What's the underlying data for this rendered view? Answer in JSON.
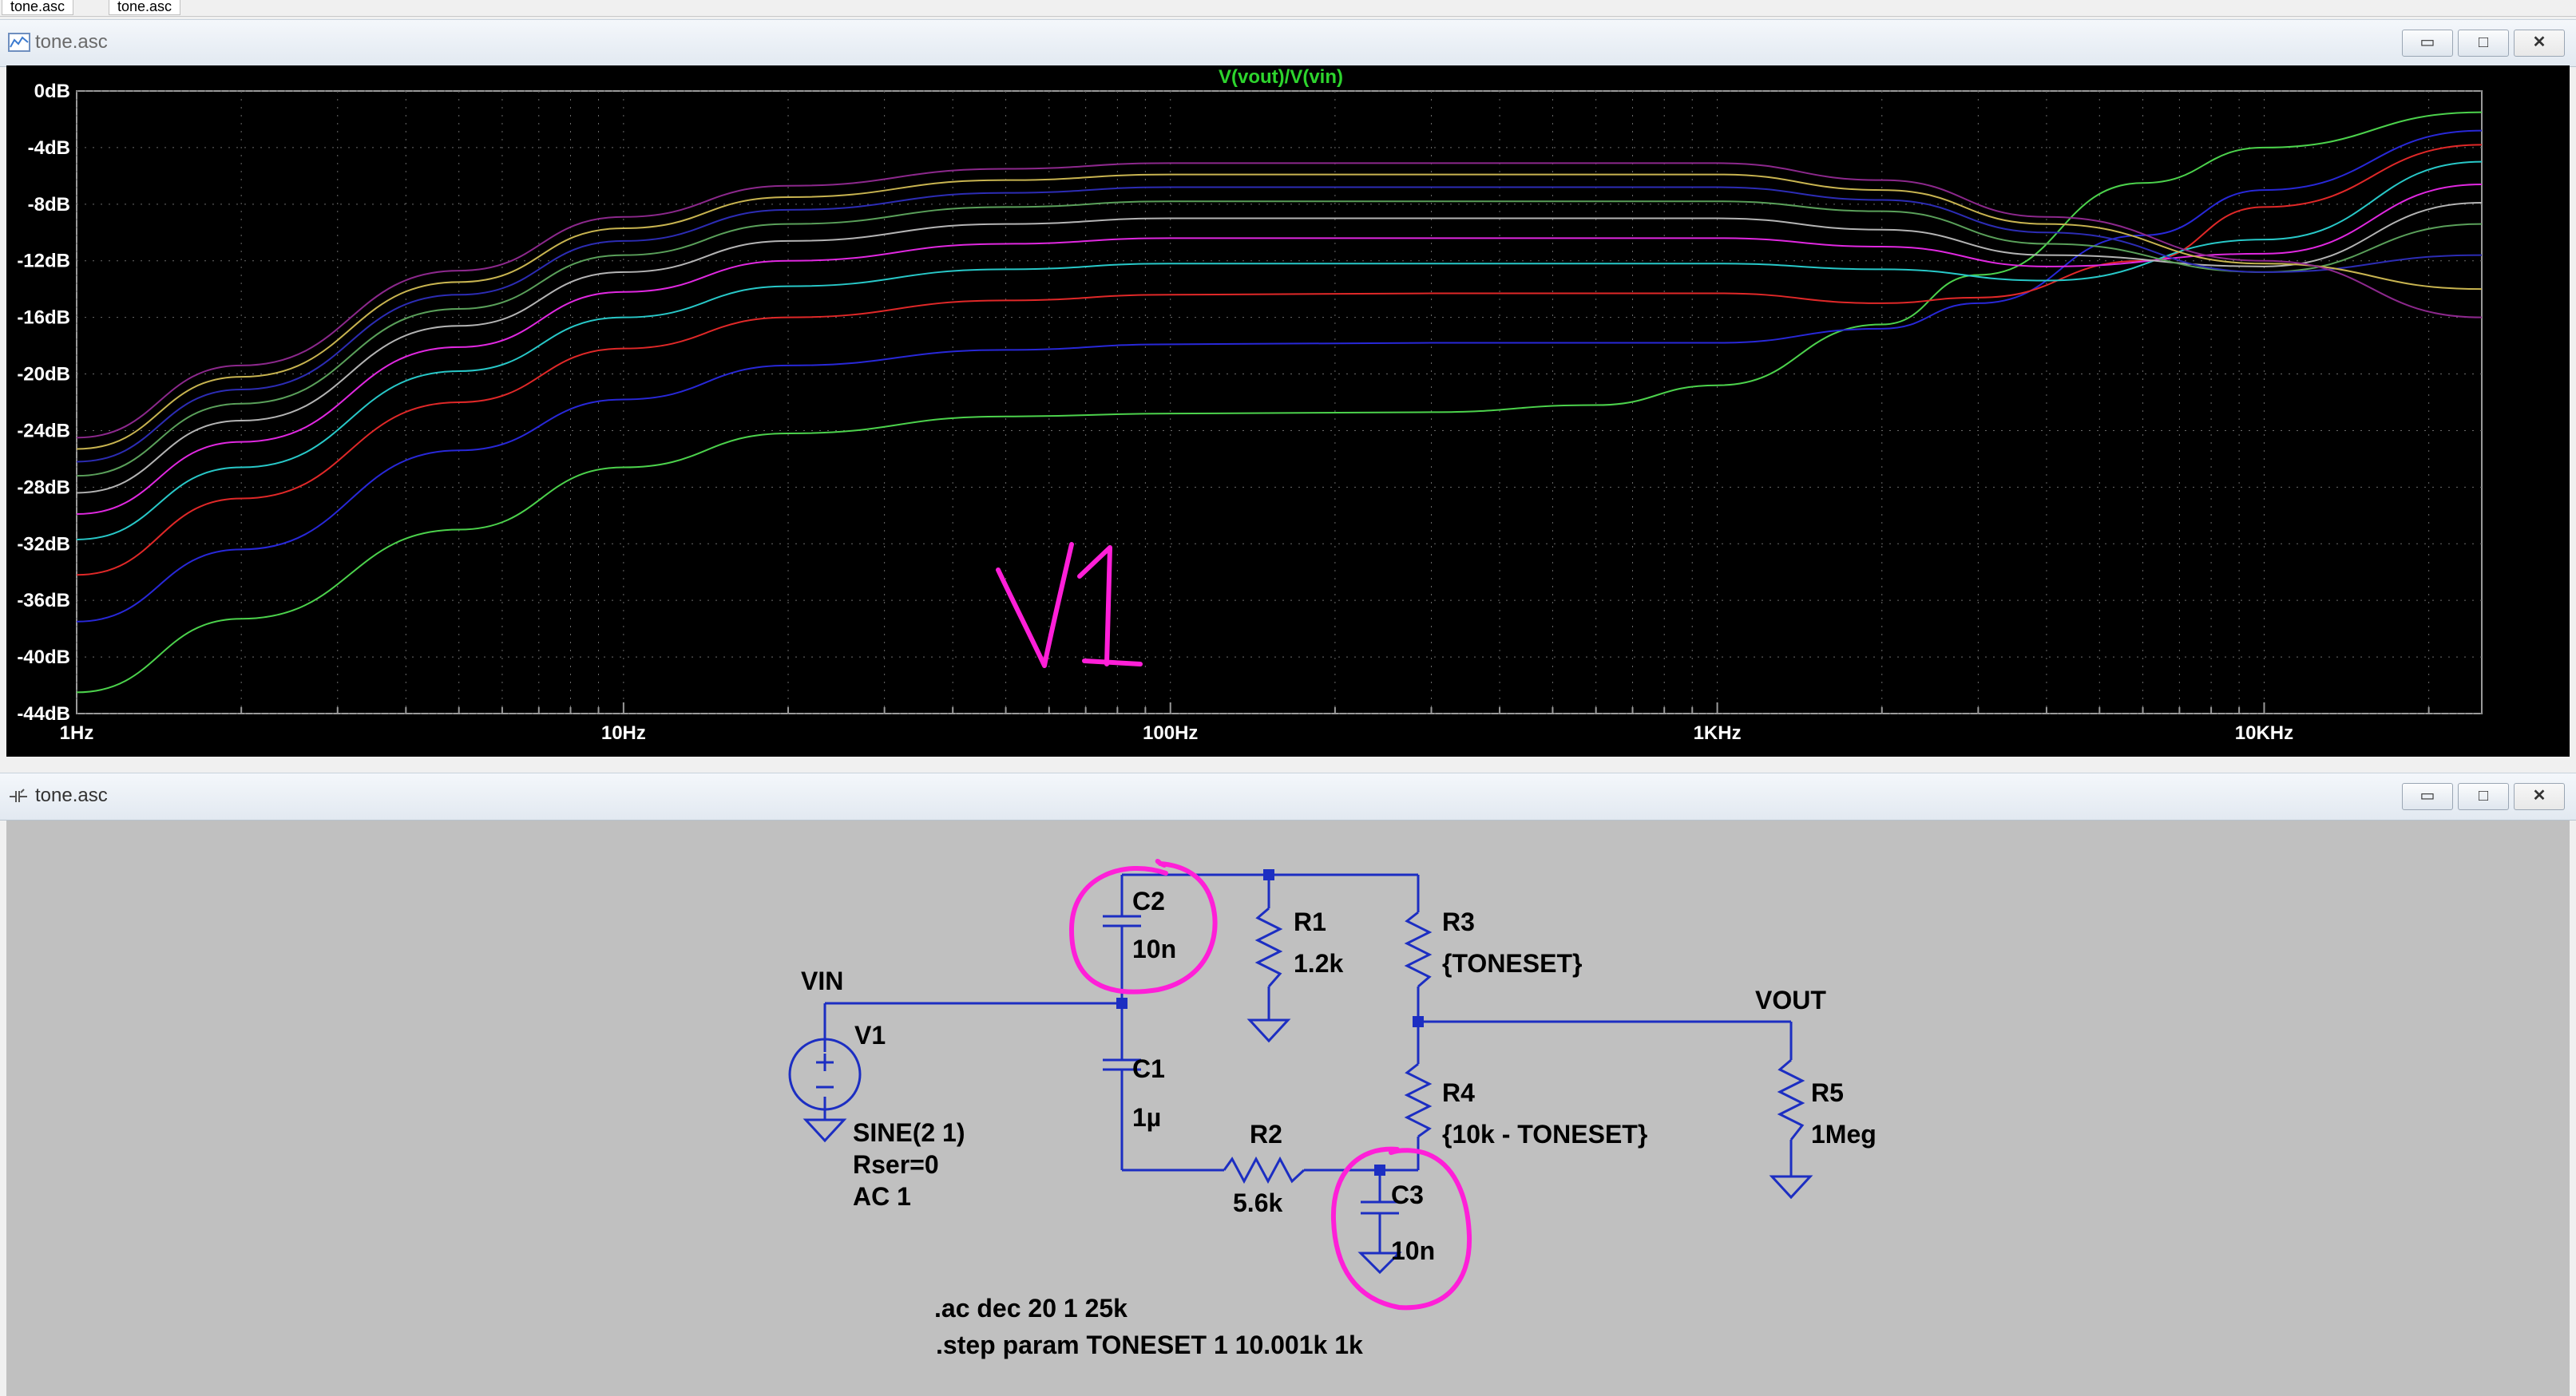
{
  "tabs": [
    "tone.asc",
    "tone.asc"
  ],
  "plot_window": {
    "title": "tone.asc",
    "buttons": {
      "minimize": "▭",
      "maximize": "□",
      "close": "✕"
    }
  },
  "schematic_window": {
    "title": "tone.asc",
    "buttons": {
      "minimize": "▭",
      "maximize": "□",
      "close": "✕"
    }
  },
  "chart_data": {
    "type": "line",
    "title": "V(vout)/V(vin)",
    "xscale": "log",
    "xlim": [
      1,
      25000
    ],
    "ylim": [
      -44,
      0
    ],
    "yticks": [
      "0dB",
      "-4dB",
      "-8dB",
      "-12dB",
      "-16dB",
      "-20dB",
      "-24dB",
      "-28dB",
      "-32dB",
      "-36dB",
      "-40dB",
      "-44dB"
    ],
    "xticks": [
      "1Hz",
      "10Hz",
      "100Hz",
      "1KHz",
      "10KHz"
    ],
    "grid": true,
    "series": [
      {
        "color": "#4cd24c",
        "points": [
          [
            1,
            -42.5
          ],
          [
            2,
            -37.3
          ],
          [
            5,
            -31
          ],
          [
            10,
            -26.6
          ],
          [
            20,
            -24.2
          ],
          [
            50,
            -23
          ],
          [
            100,
            -22.8
          ],
          [
            300,
            -22.7
          ],
          [
            600,
            -22.2
          ],
          [
            1000,
            -20.8
          ],
          [
            2000,
            -16.5
          ],
          [
            3000,
            -13
          ],
          [
            6000,
            -6.5
          ],
          [
            10000,
            -4
          ],
          [
            25000,
            -1.5
          ]
        ]
      },
      {
        "color": "#2828d8",
        "points": [
          [
            1,
            -37.5
          ],
          [
            2,
            -32.4
          ],
          [
            5,
            -25.4
          ],
          [
            10,
            -21.8
          ],
          [
            20,
            -19.4
          ],
          [
            50,
            -18.3
          ],
          [
            100,
            -17.9
          ],
          [
            300,
            -17.8
          ],
          [
            1000,
            -17.8
          ],
          [
            2000,
            -16.8
          ],
          [
            3000,
            -15
          ],
          [
            6000,
            -10.2
          ],
          [
            10000,
            -7
          ],
          [
            25000,
            -2.8
          ]
        ]
      },
      {
        "color": "#e02828",
        "points": [
          [
            1,
            -34.2
          ],
          [
            2,
            -28.8
          ],
          [
            5,
            -22
          ],
          [
            10,
            -18.2
          ],
          [
            20,
            -16
          ],
          [
            50,
            -14.8
          ],
          [
            100,
            -14.4
          ],
          [
            300,
            -14.3
          ],
          [
            1000,
            -14.3
          ],
          [
            2000,
            -15
          ],
          [
            3000,
            -14.6
          ],
          [
            6000,
            -12
          ],
          [
            10000,
            -8.2
          ],
          [
            25000,
            -3.8
          ]
        ]
      },
      {
        "color": "#28c8c8",
        "points": [
          [
            1,
            -31.7
          ],
          [
            2,
            -26.6
          ],
          [
            5,
            -19.8
          ],
          [
            10,
            -16
          ],
          [
            20,
            -13.8
          ],
          [
            50,
            -12.6
          ],
          [
            100,
            -12.2
          ],
          [
            1000,
            -12.2
          ],
          [
            2000,
            -12.6
          ],
          [
            4000,
            -13.4
          ],
          [
            10000,
            -10.5
          ],
          [
            25000,
            -5
          ]
        ]
      },
      {
        "color": "#e028e0",
        "points": [
          [
            1,
            -29.9
          ],
          [
            2,
            -24.8
          ],
          [
            5,
            -18.1
          ],
          [
            10,
            -14.2
          ],
          [
            20,
            -12
          ],
          [
            50,
            -10.8
          ],
          [
            100,
            -10.4
          ],
          [
            1000,
            -10.4
          ],
          [
            2000,
            -11
          ],
          [
            4000,
            -12.4
          ],
          [
            10000,
            -11.5
          ],
          [
            25000,
            -6.6
          ]
        ]
      },
      {
        "color": "#b4b4b4",
        "points": [
          [
            1,
            -28.4
          ],
          [
            2,
            -23.3
          ],
          [
            5,
            -16.6
          ],
          [
            10,
            -12.8
          ],
          [
            20,
            -10.6
          ],
          [
            50,
            -9.4
          ],
          [
            100,
            -9
          ],
          [
            1000,
            -9
          ],
          [
            2000,
            -9.8
          ],
          [
            4000,
            -11.6
          ],
          [
            10000,
            -12.4
          ],
          [
            25000,
            -7.9
          ]
        ]
      },
      {
        "color": "#5aa05a",
        "points": [
          [
            1,
            -27.2
          ],
          [
            2,
            -22.1
          ],
          [
            5,
            -15.4
          ],
          [
            10,
            -11.6
          ],
          [
            20,
            -9.4
          ],
          [
            50,
            -8.2
          ],
          [
            100,
            -7.8
          ],
          [
            1000,
            -7.8
          ],
          [
            2000,
            -8.5
          ],
          [
            4000,
            -10.8
          ],
          [
            10000,
            -12.8
          ],
          [
            25000,
            -9.4
          ]
        ]
      },
      {
        "color": "#2c2cb4",
        "points": [
          [
            1,
            -26.2
          ],
          [
            2,
            -21.1
          ],
          [
            5,
            -14.4
          ],
          [
            10,
            -10.6
          ],
          [
            20,
            -8.4
          ],
          [
            50,
            -7.2
          ],
          [
            100,
            -6.8
          ],
          [
            1000,
            -6.8
          ],
          [
            2000,
            -7.7
          ],
          [
            4000,
            -10
          ],
          [
            10000,
            -12.8
          ],
          [
            25000,
            -11.6
          ]
        ]
      },
      {
        "color": "#c8b450",
        "points": [
          [
            1,
            -25.3
          ],
          [
            2,
            -20.2
          ],
          [
            5,
            -13.5
          ],
          [
            10,
            -9.7
          ],
          [
            20,
            -7.5
          ],
          [
            50,
            -6.3
          ],
          [
            100,
            -5.9
          ],
          [
            1000,
            -5.9
          ],
          [
            2000,
            -7
          ],
          [
            4000,
            -9.4
          ],
          [
            10000,
            -12.2
          ],
          [
            25000,
            -14
          ]
        ]
      },
      {
        "color": "#8c288c",
        "points": [
          [
            1,
            -24.5
          ],
          [
            2,
            -19.4
          ],
          [
            5,
            -12.7
          ],
          [
            10,
            -8.9
          ],
          [
            20,
            -6.7
          ],
          [
            50,
            -5.5
          ],
          [
            100,
            -5.1
          ],
          [
            1000,
            -5.1
          ],
          [
            2000,
            -6.3
          ],
          [
            4000,
            -8.9
          ],
          [
            10000,
            -12
          ],
          [
            25000,
            -16
          ]
        ]
      }
    ]
  },
  "annotation": {
    "text": "V1",
    "color": "#ff1fd8"
  },
  "schematic": {
    "labels": {
      "vin": "VIN",
      "vout": "VOUT",
      "v1": "V1",
      "v1_sine": "SINE(2 1)",
      "v1_rser": "Rser=0",
      "v1_ac": "AC 1",
      "c1": "C1",
      "c1_val": "1µ",
      "c2": "C2",
      "c2_val": "10n",
      "c3": "C3",
      "c3_val": "10n",
      "r1": "R1",
      "r1_val": "1.2k",
      "r2": "R2",
      "r2_val": "5.6k",
      "r3": "R3",
      "r3_val": "{TONESET}",
      "r4": "R4",
      "r4_val": "{10k - TONESET}",
      "r5": "R5",
      "r5_val": "1Meg",
      "directive_ac": ".ac dec 20 1 25k",
      "directive_step": ".step param TONESET 1 10.001k 1k"
    },
    "wire_color": "#1c2ec2",
    "highlight_color": "#ff1fd8"
  }
}
